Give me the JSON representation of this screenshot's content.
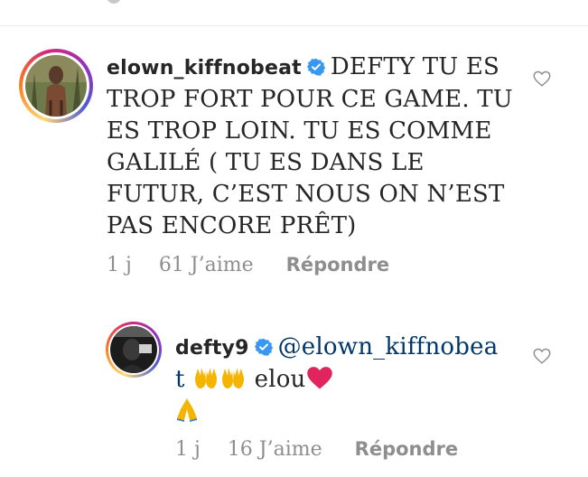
{
  "comments": [
    {
      "username": "elown_kiffnobeat",
      "verified": true,
      "text": "DEFTY TU ES TROP FORT POUR CE GAME. TU ES TROP LOIN.  TU ES COMME GALILÉ ( TU ES DANS LE FUTUR, C’EST NOUS ON N’EST PAS ENCORE PRÊT)",
      "time": "1 j",
      "likes": "61 J’aime",
      "reply_label": "Répondre"
    }
  ],
  "replies": [
    {
      "username": "defty9",
      "verified": true,
      "mention": "@elown_kiffnobeat",
      "text_after": "elou",
      "time": "1 j",
      "likes": "16 J’aime",
      "reply_label": "Répondre"
    }
  ],
  "icons": {
    "like": "heart-outline-icon",
    "verified": "verified-badge-icon"
  },
  "colors": {
    "verified_blue": "#3897f0",
    "meta_gray": "#8e8e8e",
    "mention_blue": "#00376b"
  }
}
